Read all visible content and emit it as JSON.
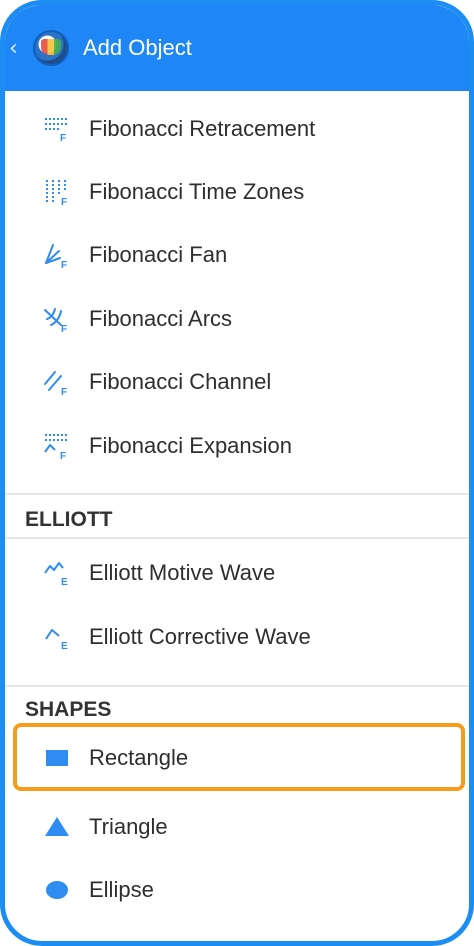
{
  "header": {
    "title": "Add Object",
    "back_icon": "chevron-left-icon"
  },
  "fibonacci": [
    {
      "label": "Fibonacci Retracement",
      "icon": "fibonacci-retracement-icon"
    },
    {
      "label": "Fibonacci Time Zones",
      "icon": "fibonacci-time-zones-icon"
    },
    {
      "label": "Fibonacci Fan",
      "icon": "fibonacci-fan-icon"
    },
    {
      "label": "Fibonacci Arcs",
      "icon": "fibonacci-arcs-icon"
    },
    {
      "label": "Fibonacci Channel",
      "icon": "fibonacci-channel-icon"
    },
    {
      "label": "Fibonacci Expansion",
      "icon": "fibonacci-expansion-icon"
    }
  ],
  "elliott": {
    "title": "ELLIOTT",
    "items": [
      {
        "label": "Elliott Motive Wave",
        "icon": "elliott-motive-wave-icon"
      },
      {
        "label": "Elliott Corrective Wave",
        "icon": "elliott-corrective-wave-icon"
      }
    ]
  },
  "shapes": {
    "title": "SHAPES",
    "items": [
      {
        "label": "Rectangle",
        "icon": "rectangle-icon",
        "highlighted": true
      },
      {
        "label": "Triangle",
        "icon": "triangle-icon"
      },
      {
        "label": "Ellipse",
        "icon": "ellipse-icon"
      }
    ]
  },
  "colors": {
    "accent": "#1e86f5",
    "icon": "#2f8cf0",
    "highlight": "#f59c1a"
  }
}
